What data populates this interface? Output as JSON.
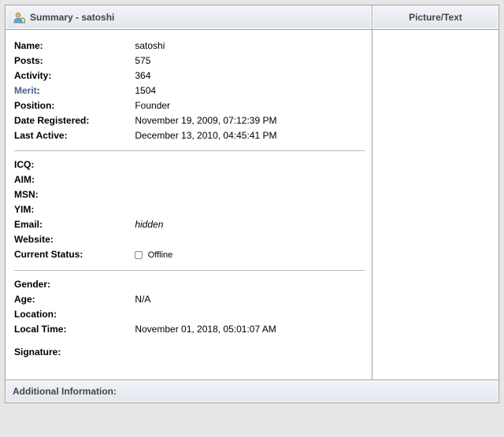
{
  "header": {
    "summary_prefix": "Summary - ",
    "username": "satoshi",
    "picture_text": "Picture/Text"
  },
  "section1": {
    "name_label": "Name:",
    "name_value": "satoshi",
    "posts_label": "Posts:",
    "posts_value": "575",
    "activity_label": "Activity:",
    "activity_value": "364",
    "merit_label": "Merit",
    "merit_colon": ":",
    "merit_value": "1504",
    "position_label": "Position:",
    "position_value": "Founder",
    "date_reg_label": "Date Registered:",
    "date_reg_value": "November 19, 2009, 07:12:39 PM",
    "last_active_label": "Last Active:",
    "last_active_value": "December 13, 2010, 04:45:41 PM"
  },
  "section2": {
    "icq_label": "ICQ:",
    "aim_label": "AIM:",
    "msn_label": "MSN:",
    "yim_label": "YIM:",
    "email_label": "Email:",
    "email_value": "hidden",
    "website_label": "Website:",
    "status_label": "Current Status:",
    "status_value": "Offline"
  },
  "section3": {
    "gender_label": "Gender:",
    "age_label": "Age:",
    "age_value": "N/A",
    "location_label": "Location:",
    "localtime_label": "Local Time:",
    "localtime_value": "November 01, 2018, 05:01:07 AM",
    "signature_label": "Signature:"
  },
  "additional": {
    "title": "Additional Information:"
  }
}
